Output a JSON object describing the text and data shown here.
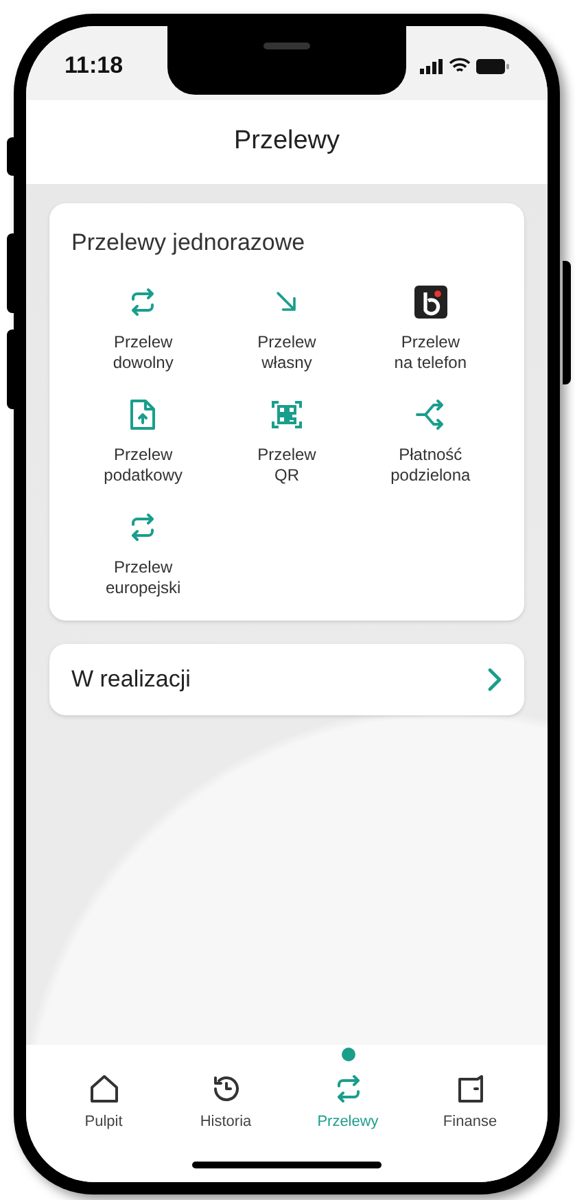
{
  "status_bar": {
    "time": "11:18"
  },
  "header": {
    "title": "Przelewy"
  },
  "section": {
    "title": "Przelewy jednorazowe",
    "items": [
      {
        "line1": "Przelew",
        "line2": "dowolny"
      },
      {
        "line1": "Przelew",
        "line2": "własny"
      },
      {
        "line1": "Przelew",
        "line2": "na telefon"
      },
      {
        "line1": "Przelew",
        "line2": "podatkowy"
      },
      {
        "line1": "Przelew",
        "line2": "QR"
      },
      {
        "line1": "Płatność",
        "line2": "podzielona"
      },
      {
        "line1": "Przelew",
        "line2": "europejski"
      }
    ]
  },
  "in_progress": {
    "label": "W realizacji"
  },
  "bottom_nav": [
    {
      "label": "Pulpit",
      "selected": false
    },
    {
      "label": "Historia",
      "selected": false
    },
    {
      "label": "Przelewy",
      "selected": true
    },
    {
      "label": "Finanse",
      "selected": false
    }
  ]
}
